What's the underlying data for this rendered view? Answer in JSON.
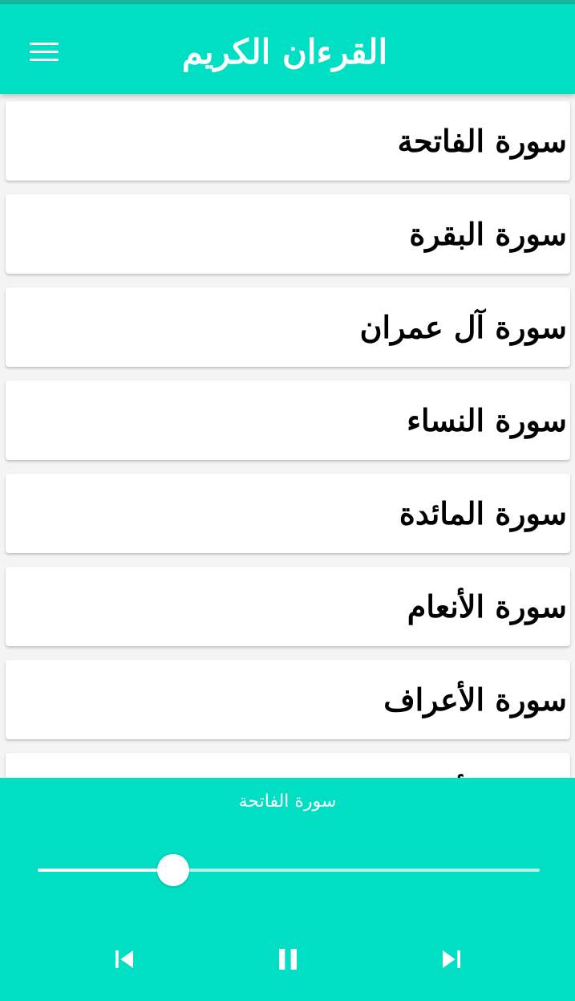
{
  "app_bar": {
    "title": "القرءان الكريم",
    "menu_icon": "hamburger-menu-icon",
    "background": "#00dfc4"
  },
  "surahs": [
    "سورة الفاتحة",
    "سورة البقرة",
    "سورة آل عمران",
    "سورة النساء",
    "سورة المائدة",
    "سورة الأنعام",
    "سورة الأعراف",
    "سورة الأنفال"
  ],
  "player": {
    "now_playing": "سورة الفاتحة",
    "progress": 0.27,
    "controls": {
      "previous_icon": "skip-previous-icon",
      "pause_icon": "pause-icon",
      "next_icon": "skip-next-icon"
    },
    "background": "#00dfc4"
  }
}
